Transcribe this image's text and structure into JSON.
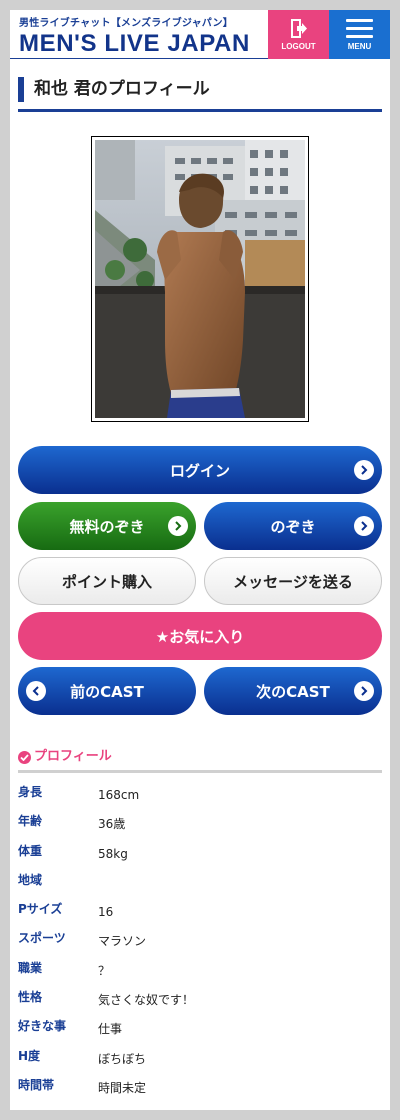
{
  "header": {
    "subtitle": "男性ライブチャット【メンズライブジャパン】",
    "title": "MEN'S LIVE JAPAN",
    "logout_label": "LOGOUT",
    "menu_label": "MENU",
    "accent_blue": "#1a3f95",
    "accent_pink": "#e9437f"
  },
  "page": {
    "title": "和也 君のプロフィール"
  },
  "buttons": {
    "login": "ログイン",
    "free_peek": "無料のぞき",
    "peek": "のぞき",
    "buy_points": "ポイント購入",
    "send_message": "メッセージを送る",
    "favorite": "★お気に入り",
    "prev_cast": "前のCAST",
    "next_cast": "次のCAST"
  },
  "profile": {
    "heading": "プロフィール",
    "rows": [
      {
        "key": "身長",
        "value": "168cm"
      },
      {
        "key": "年齢",
        "value": "36歳"
      },
      {
        "key": "体重",
        "value": "58kg"
      },
      {
        "key": "地域",
        "value": ""
      },
      {
        "key": "Pサイズ",
        "value": "16"
      },
      {
        "key": "スポーツ",
        "value": "マラソン"
      },
      {
        "key": "職業",
        "value": "？"
      },
      {
        "key": "性格",
        "value": "気さくな奴です！"
      },
      {
        "key": "好きな事",
        "value": "仕事"
      },
      {
        "key": "H度",
        "value": "ぼちぼち"
      },
      {
        "key": "時間帯",
        "value": "時間未定"
      }
    ]
  }
}
